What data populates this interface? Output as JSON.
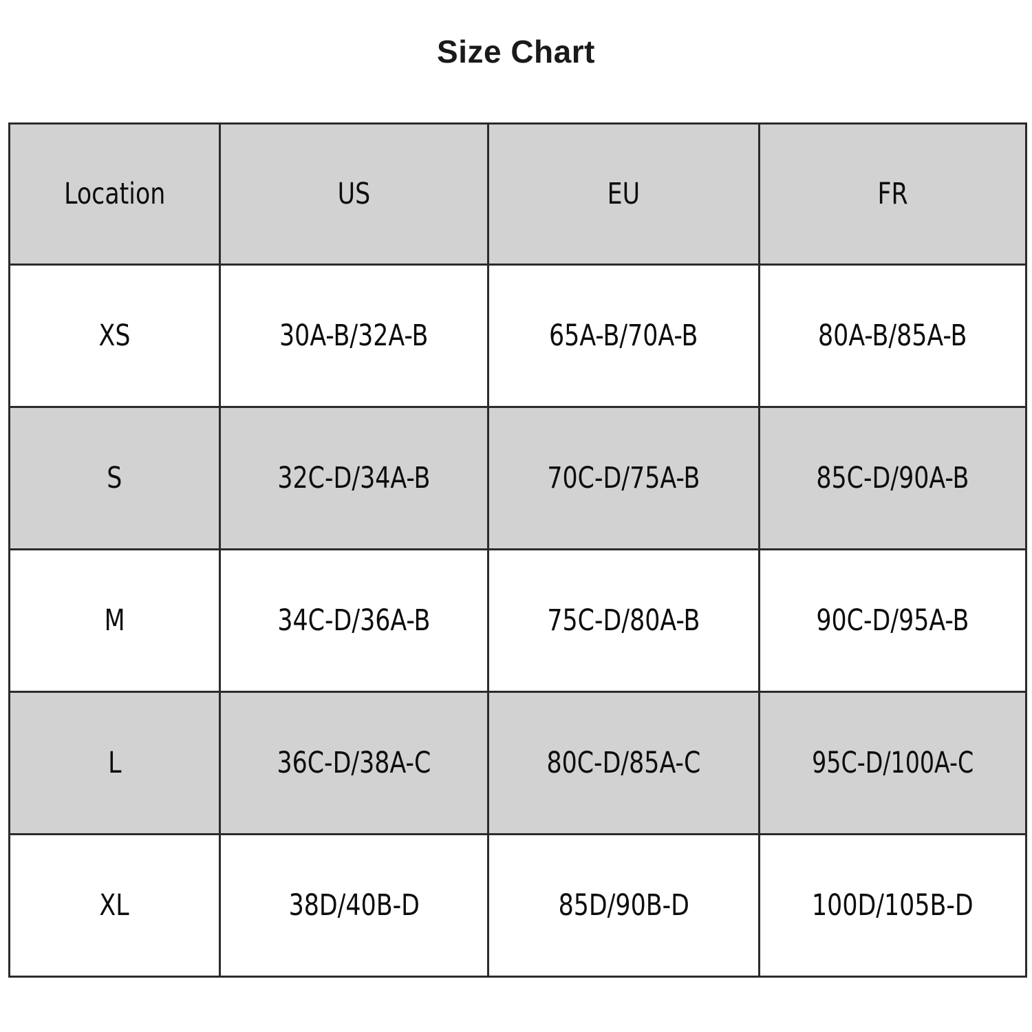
{
  "title": "Size Chart",
  "table": {
    "columns": [
      "Location",
      "US",
      "EU",
      "FR"
    ],
    "rows": [
      {
        "location": "XS",
        "us": "30A-B/32A-B",
        "eu": "65A-B/70A-B",
        "fr": "80A-B/85A-B"
      },
      {
        "location": "S",
        "us": "32C-D/34A-B",
        "eu": "70C-D/75A-B",
        "fr": "85C-D/90A-B"
      },
      {
        "location": "M",
        "us": "34C-D/36A-B",
        "eu": "75C-D/80A-B",
        "fr": "90C-D/95A-B"
      },
      {
        "location": "L",
        "us": "36C-D/38A-C",
        "eu": "80C-D/85A-C",
        "fr": "95C-D/100A-C"
      },
      {
        "location": "XL",
        "us": "38D/40B-D",
        "eu": "85D/90B-D",
        "fr": "100D/105B-D"
      }
    ]
  },
  "colors": {
    "shaded_row": "#d2d2d2",
    "border": "#2b2b2b",
    "text": "#0d0d0d",
    "background": "#ffffff"
  }
}
